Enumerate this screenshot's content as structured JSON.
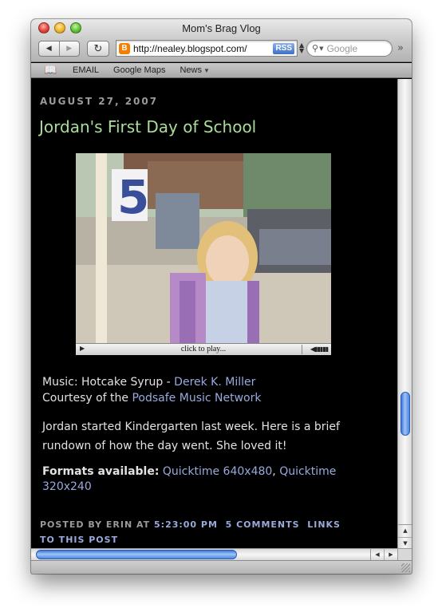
{
  "window": {
    "title": "Mom's Brag Vlog"
  },
  "toolbar": {
    "back_icon": "back-arrow-icon",
    "forward_icon": "forward-arrow-icon",
    "reload_icon": "reload-icon",
    "url": "http://nealey.blogspot.com/",
    "favicon_letter": "B",
    "rss_label": "RSS",
    "search_placeholder": "Google",
    "overflow_icon": "chevron-double-right-icon"
  },
  "bookmarks": {
    "icon": "book-icon",
    "items": [
      {
        "label": "EMAIL"
      },
      {
        "label": "Google Maps"
      },
      {
        "label": "News"
      }
    ]
  },
  "post": {
    "date": "AUGUST 27, 2007",
    "title": "Jordan's First Day of School",
    "video": {
      "click_label": "click to play...",
      "play_icon": "play-icon",
      "volume_icon": "volume-icon"
    },
    "music_prefix": "Music: Hotcake Syrup - ",
    "music_artist": "Derek K. Miller",
    "courtesy_prefix": "Courtesy of the ",
    "courtesy_link": "Podsafe Music Network",
    "body": "Jordan started Kindergarten last week. Here is a brief rundown of how the day went. She loved it!",
    "formats_label": "Formats available:",
    "formats": [
      {
        "label": "Quicktime 640x480"
      },
      {
        "label": "Quicktime 320x240"
      }
    ],
    "footer": {
      "posted_by": "POSTED BY ERIN AT",
      "time": "5:23:00 PM",
      "comments": "5 COMMENTS",
      "links": "LINKS TO THIS POST"
    }
  },
  "colors": {
    "title_green": "#aadd99",
    "link_blue": "#99aadd",
    "background": "#000000"
  }
}
